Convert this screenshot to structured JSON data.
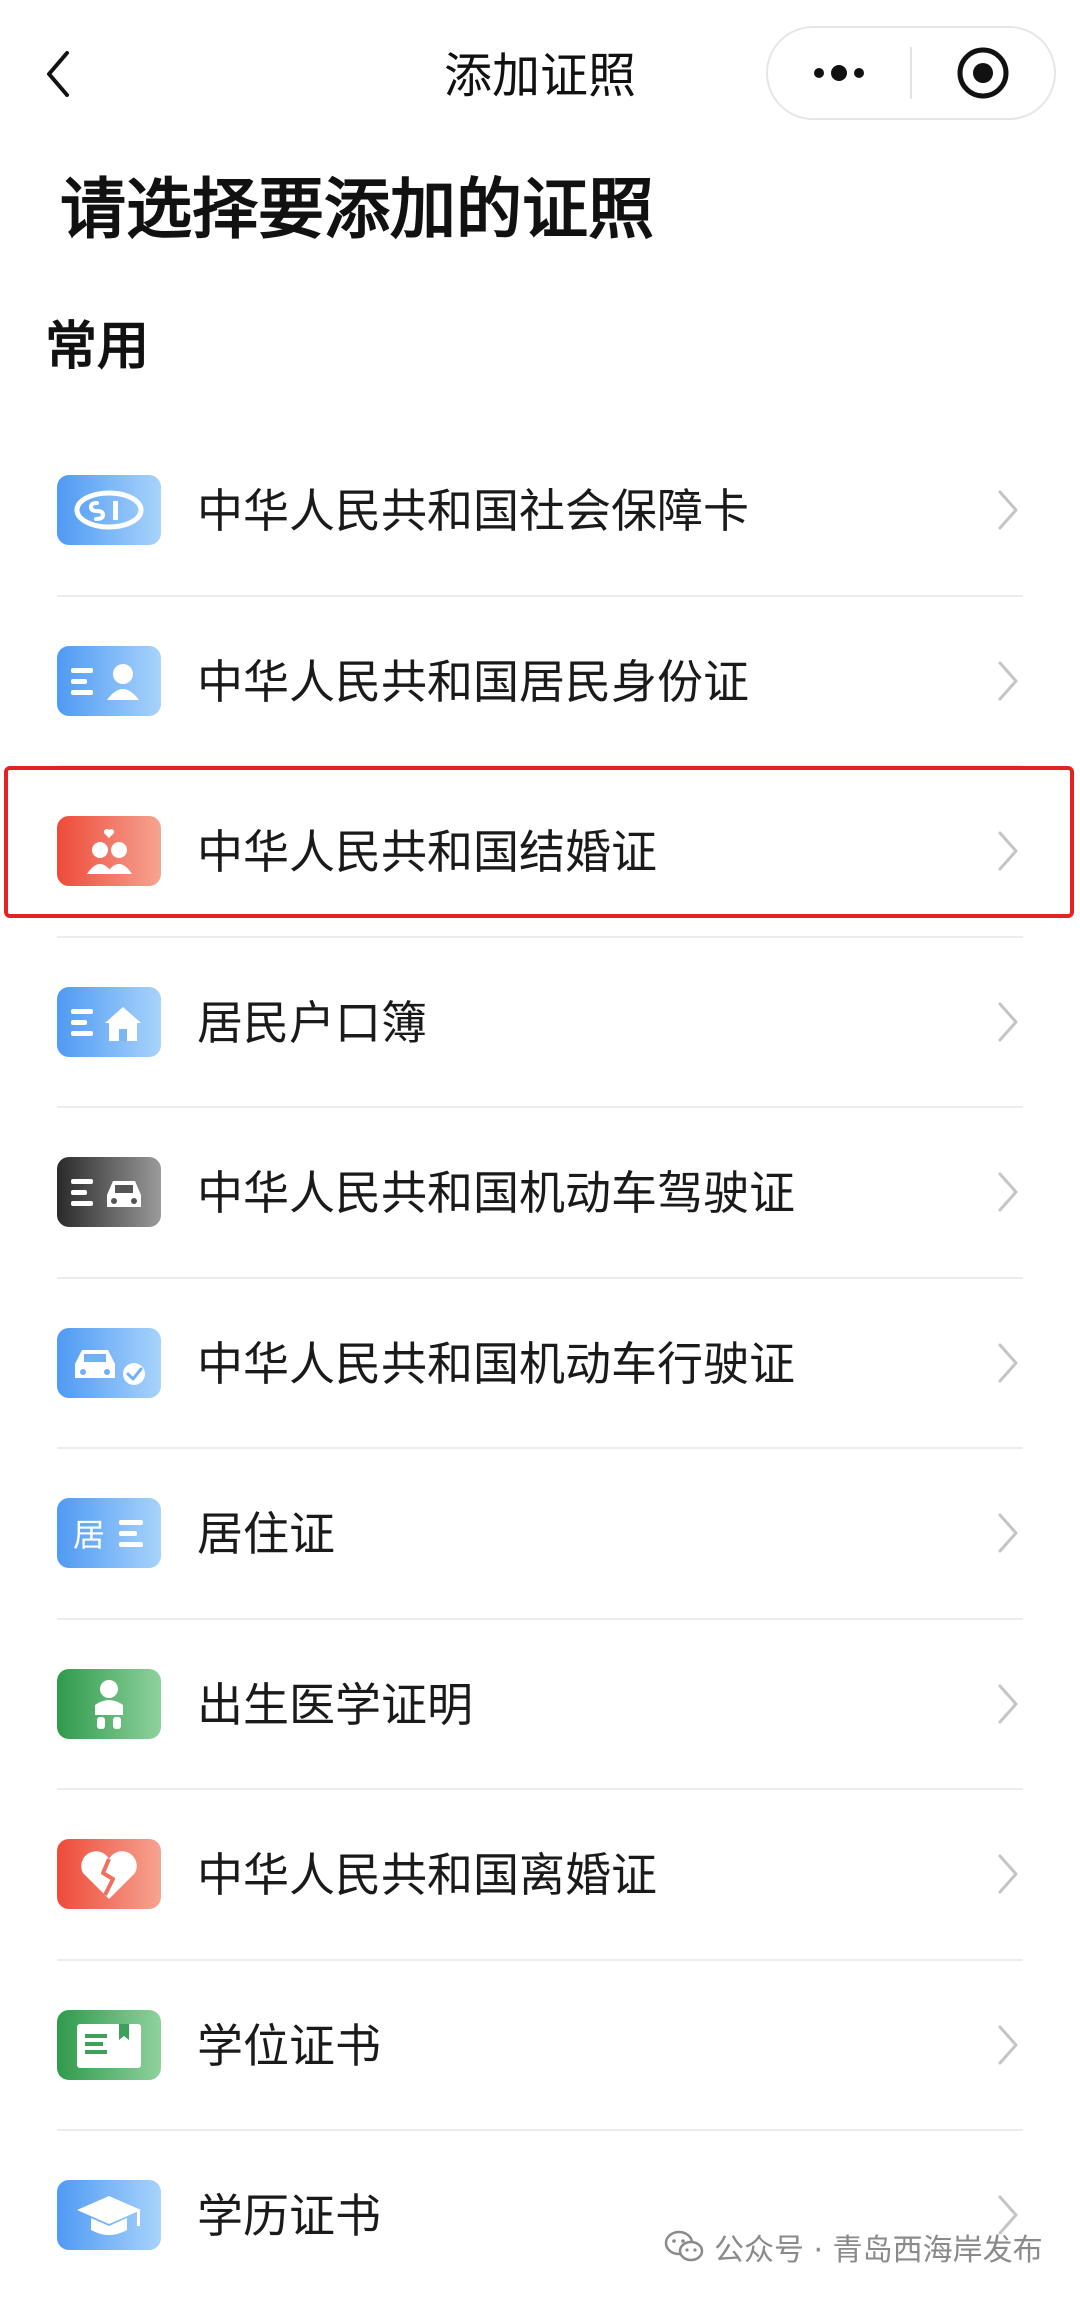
{
  "nav": {
    "title": "添加证照"
  },
  "page": {
    "heading": "请选择要添加的证照",
    "section_title": "常用"
  },
  "list": {
    "items": [
      {
        "label": "中华人民共和国社会保障卡",
        "icon": "social-security-card-icon"
      },
      {
        "label": "中华人民共和国居民身份证",
        "icon": "id-card-icon"
      },
      {
        "label": "中华人民共和国结婚证",
        "icon": "marriage-certificate-icon"
      },
      {
        "label": "居民户口簿",
        "icon": "household-register-icon"
      },
      {
        "label": "中华人民共和国机动车驾驶证",
        "icon": "driver-license-icon"
      },
      {
        "label": "中华人民共和国机动车行驶证",
        "icon": "vehicle-license-icon"
      },
      {
        "label": "居住证",
        "icon": "residence-permit-icon",
        "icon_text": "居"
      },
      {
        "label": "出生医学证明",
        "icon": "birth-certificate-icon"
      },
      {
        "label": "中华人民共和国离婚证",
        "icon": "divorce-certificate-icon"
      },
      {
        "label": "学位证书",
        "icon": "degree-certificate-icon"
      },
      {
        "label": "学历证书",
        "icon": "diploma-icon"
      }
    ]
  },
  "watermark": {
    "text": "公众号 · 青岛西海岸发布"
  },
  "colors": {
    "blue_start": "#4f9af3",
    "blue_end": "#a8d3fb",
    "red_start": "#ee4a3a",
    "red_end": "#f6a491",
    "dark_start": "#2a2a2a",
    "dark_end": "#9a9a9a",
    "green_start": "#2f9a4b",
    "green_end": "#8fd19e",
    "highlight": "#e52222"
  }
}
